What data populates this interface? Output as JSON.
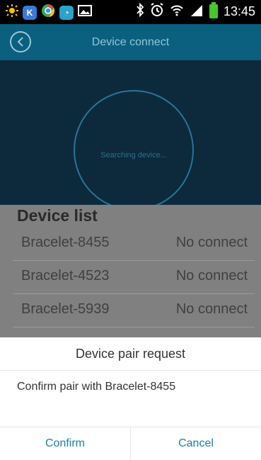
{
  "status_bar": {
    "time": "13:45",
    "icons": [
      "brightness-icon",
      "app-k-icon",
      "chrome-icon",
      "app-icon",
      "image-icon",
      "bluetooth-icon",
      "alarm-icon",
      "wifi-icon",
      "signal-icon",
      "battery-icon"
    ]
  },
  "app_bar": {
    "title": "Device connect"
  },
  "search": {
    "status_text": "Searching device..."
  },
  "device_list": {
    "header": "Device list",
    "items": [
      {
        "name": "Bracelet-8455",
        "status": "No connect"
      },
      {
        "name": "Bracelet-4523",
        "status": "No connect"
      },
      {
        "name": "Bracelet-5939",
        "status": "No connect"
      }
    ]
  },
  "dialog": {
    "title": "Device pair request",
    "message": "Confirm pair with Bracelet-8455",
    "confirm_label": "Confirm",
    "cancel_label": "Cancel"
  },
  "colors": {
    "app_bar": "#0b5f7f",
    "search_bg": "#0c2a3c",
    "list_bg": "#808080",
    "dialog_button_text": "#1b7fb0"
  }
}
